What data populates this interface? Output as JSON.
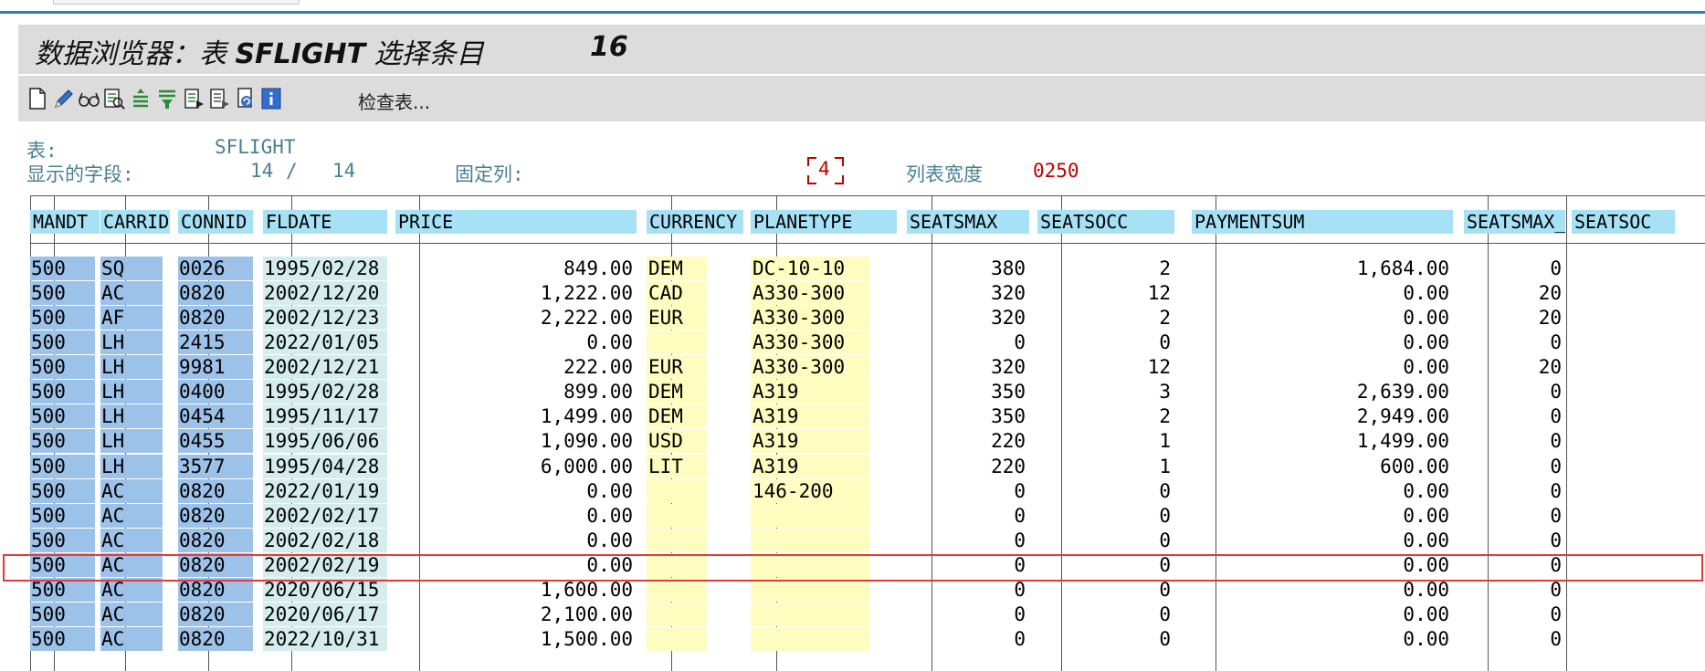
{
  "window": {
    "title_prefix": "数据浏览器：表",
    "table_name": "SFLIGHT",
    "title_suffix": "选择条目",
    "entry_count": "16"
  },
  "toolbar": {
    "icons": [
      "new-document-icon",
      "edit-pencil-icon",
      "glasses-display-icon",
      "details-icon",
      "sort-ascending-icon",
      "filter-icon",
      "export-list-icon",
      "print-icon",
      "refresh-icon",
      "info-icon"
    ],
    "check_table_label": "检查表..."
  },
  "info": {
    "table_label": "表:",
    "table_value": "SFLIGHT",
    "fields_label": "显示的字段:",
    "fields_shown": "14",
    "fields_sep": "/",
    "fields_total": "14",
    "fixed_cols_label": "固定列:",
    "fixed_cols_value": "4",
    "list_width_label": "列表宽度",
    "list_width_value": "0250"
  },
  "colors": {
    "key_bg": "#9cc2ea",
    "date_bg": "#d4ecec",
    "yellow_bg": "#fdfdc0",
    "header_bg": "#a6e1f5",
    "accent_red": "#c00000",
    "selection_border": "#e53a3a"
  },
  "columns": [
    "MANDT",
    "CARRID",
    "CONNID",
    "FLDATE",
    "PRICE",
    "CURRENCY",
    "PLANETYPE",
    "SEATSMAX",
    "SEATSOCC",
    "PAYMENTSUM",
    "SEATSMAX_B",
    "SEATSOC"
  ],
  "rows": [
    [
      "500",
      "SQ",
      "0026",
      "1995/02/28",
      "849.00",
      "DEM",
      "DC-10-10",
      "380",
      "2",
      "1,684.00",
      "0",
      ""
    ],
    [
      "500",
      "AC",
      "0820",
      "2002/12/20",
      "1,222.00",
      "CAD",
      "A330-300",
      "320",
      "12",
      "0.00",
      "20",
      ""
    ],
    [
      "500",
      "AF",
      "0820",
      "2002/12/23",
      "2,222.00",
      "EUR",
      "A330-300",
      "320",
      "2",
      "0.00",
      "20",
      ""
    ],
    [
      "500",
      "LH",
      "2415",
      "2022/01/05",
      "0.00",
      "",
      "A330-300",
      "0",
      "0",
      "0.00",
      "0",
      ""
    ],
    [
      "500",
      "LH",
      "9981",
      "2002/12/21",
      "222.00",
      "EUR",
      "A330-300",
      "320",
      "12",
      "0.00",
      "20",
      ""
    ],
    [
      "500",
      "LH",
      "0400",
      "1995/02/28",
      "899.00",
      "DEM",
      "A319",
      "350",
      "3",
      "2,639.00",
      "0",
      ""
    ],
    [
      "500",
      "LH",
      "0454",
      "1995/11/17",
      "1,499.00",
      "DEM",
      "A319",
      "350",
      "2",
      "2,949.00",
      "0",
      ""
    ],
    [
      "500",
      "LH",
      "0455",
      "1995/06/06",
      "1,090.00",
      "USD",
      "A319",
      "220",
      "1",
      "1,499.00",
      "0",
      ""
    ],
    [
      "500",
      "LH",
      "3577",
      "1995/04/28",
      "6,000.00",
      "LIT",
      "A319",
      "220",
      "1",
      "600.00",
      "0",
      ""
    ],
    [
      "500",
      "AC",
      "0820",
      "2022/01/19",
      "0.00",
      "",
      "146-200",
      "0",
      "0",
      "0.00",
      "0",
      ""
    ],
    [
      "500",
      "AC",
      "0820",
      "2002/02/17",
      "0.00",
      "",
      "",
      "0",
      "0",
      "0.00",
      "0",
      ""
    ],
    [
      "500",
      "AC",
      "0820",
      "2002/02/18",
      "0.00",
      "",
      "",
      "0",
      "0",
      "0.00",
      "0",
      ""
    ],
    [
      "500",
      "AC",
      "0820",
      "2002/02/19",
      "0.00",
      "",
      "",
      "0",
      "0",
      "0.00",
      "0",
      ""
    ],
    [
      "500",
      "AC",
      "0820",
      "2020/06/15",
      "1,600.00",
      "",
      "",
      "0",
      "0",
      "0.00",
      "0",
      ""
    ],
    [
      "500",
      "AC",
      "0820",
      "2020/06/17",
      "2,100.00",
      "",
      "",
      "0",
      "0",
      "0.00",
      "0",
      ""
    ],
    [
      "500",
      "AC",
      "0820",
      "2022/10/31",
      "1,500.00",
      "",
      "",
      "0",
      "0",
      "0.00",
      "0",
      ""
    ]
  ],
  "selected_row_index": 12
}
